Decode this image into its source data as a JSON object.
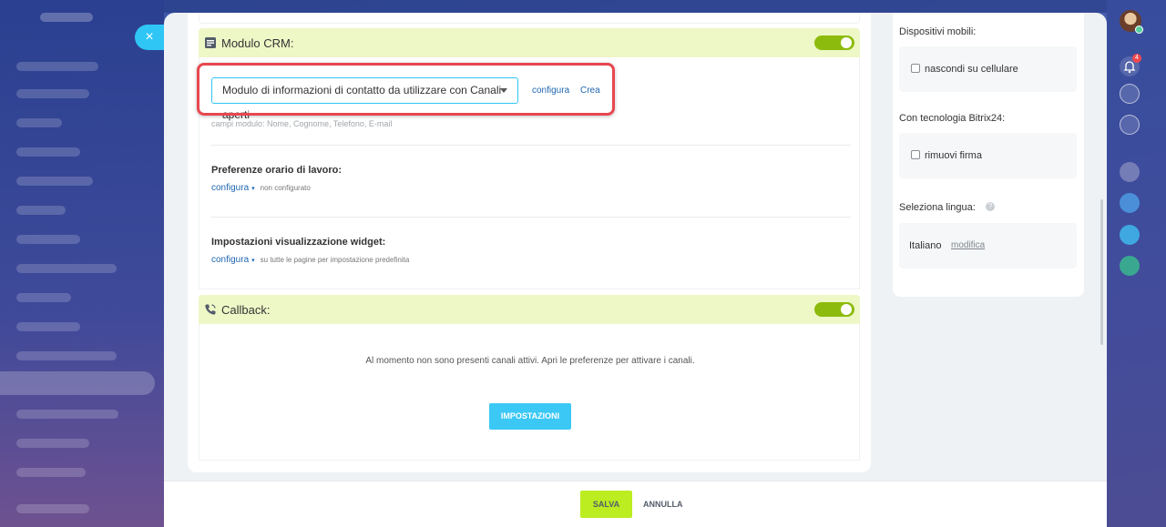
{
  "crm_section": {
    "title": "Modulo CRM:",
    "form_select_value": "Modulo di informazioni di contatto da utilizzare con Canali aperti",
    "configure_link": "configura",
    "create_link": "Crea",
    "fields_hint": "campi modulo: Nome, Cognome, Telefono, E-mail",
    "work_hours_label": "Preferenze orario di lavoro:",
    "work_hours_link": "configura",
    "work_hours_status": "non configurato",
    "widget_label": "Impostazioni visualizzazione widget:",
    "widget_link": "configura",
    "widget_status": "su tutte le pagine per impostazione predefinita",
    "enabled": true
  },
  "callback_section": {
    "title": "Callback:",
    "empty_message": "Al momento non sono presenti canali attivi. Apri le preferenze per attivare i canali.",
    "settings_button": "IMPOSTAZIONI",
    "enabled": true
  },
  "side_panel": {
    "mobile_header": "Dispositivi mobili:",
    "hide_mobile_label": "nascondi su cellulare",
    "bitrix_header": "Con tecnologia Bitrix24:",
    "remove_signature_label": "rimuovi firma",
    "language_header": "Seleziona lingua:",
    "language_value": "Italiano",
    "language_edit_link": "modifica"
  },
  "footer": {
    "save_label": "SALVA",
    "cancel_label": "ANNULLA"
  },
  "controls": {
    "close_glyph": "×",
    "caret_glyph": "▾",
    "help_glyph": "?"
  },
  "notifications": {
    "count": "4"
  },
  "colors": {
    "accent": "#2fc6f6",
    "toggle_on": "#8dbb0d",
    "section_bar": "#eef7c6",
    "save_button": "#bbed21",
    "highlight": "#e8474f"
  }
}
